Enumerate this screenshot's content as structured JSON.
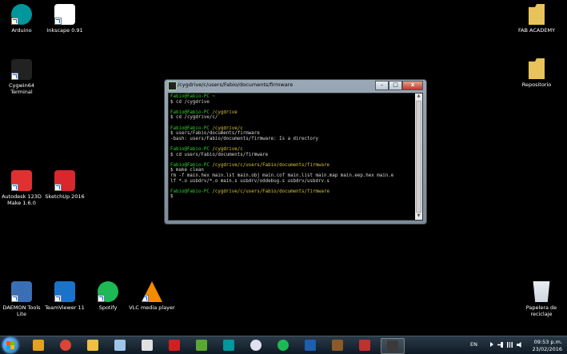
{
  "desktop": {
    "icons": [
      {
        "id": "arduino",
        "label": "Arduino",
        "icon": "arduino-icon",
        "color": "#00979c"
      },
      {
        "id": "inkscape",
        "label": "Inkscape 0.91",
        "icon": "inkscape-icon",
        "color": "#ffffff"
      },
      {
        "id": "fab",
        "label": "FAB ACADEMY",
        "icon": "folder-icon",
        "color": "#e8c35a"
      },
      {
        "id": "cygwin",
        "label": "Cygwin64\nTerminal",
        "icon": "cygwin-terminal-icon",
        "color": "#222222"
      },
      {
        "id": "repo",
        "label": "Repositorio",
        "icon": "folder-icon",
        "color": "#e8c35a"
      },
      {
        "id": "autodesk",
        "label": "Autodesk 123D\nMake 1.6.0",
        "icon": "autodesk-123d-make-icon",
        "color": "#e23030"
      },
      {
        "id": "sketchup",
        "label": "SketchUp 2016",
        "icon": "sketchup-icon",
        "color": "#d8272d"
      },
      {
        "id": "daemon",
        "label": "DAEMON Tools\nLite",
        "icon": "daemon-tools-icon",
        "color": "#3b6fb5"
      },
      {
        "id": "teamviewer",
        "label": "TeamViewer 11",
        "icon": "teamviewer-icon",
        "color": "#1a73c9"
      },
      {
        "id": "spotify",
        "label": "Spotify",
        "icon": "spotify-icon",
        "color": "#1db954"
      },
      {
        "id": "vlc",
        "label": "VLC media player",
        "icon": "vlc-icon",
        "color": "#f28b00"
      },
      {
        "id": "recycle",
        "label": "Papelera de\nreciclaje",
        "icon": "recycle-bin-icon",
        "color": "#cfd8e0"
      }
    ]
  },
  "terminal": {
    "title": "/cygdrive/c/users/Fabio/documents/firmware",
    "lines": [
      [
        {
          "c": "g",
          "t": "Fabio@Fabio-PC "
        },
        {
          "c": "y",
          "t": "~"
        }
      ],
      [
        {
          "c": "w",
          "t": "$ cd /cygdrive"
        }
      ],
      [
        {
          "c": "w",
          "t": ""
        }
      ],
      [
        {
          "c": "g",
          "t": "Fabio@Fabio-PC "
        },
        {
          "c": "y",
          "t": "/cygdrive"
        }
      ],
      [
        {
          "c": "w",
          "t": "$ cd /cygdrive/c/"
        }
      ],
      [
        {
          "c": "w",
          "t": ""
        }
      ],
      [
        {
          "c": "g",
          "t": "Fabio@Fabio-PC "
        },
        {
          "c": "y",
          "t": "/cygdrive/c"
        }
      ],
      [
        {
          "c": "w",
          "t": "$ users/Fabio/documents/firmware"
        }
      ],
      [
        {
          "c": "w",
          "t": "-bash: users/Fabio/documents/firmware: Is a directory"
        }
      ],
      [
        {
          "c": "w",
          "t": ""
        }
      ],
      [
        {
          "c": "g",
          "t": "Fabio@Fabio-PC "
        },
        {
          "c": "y",
          "t": "/cygdrive/c"
        }
      ],
      [
        {
          "c": "w",
          "t": "$ cd users/Fabio/documents/firmware"
        }
      ],
      [
        {
          "c": "w",
          "t": ""
        }
      ],
      [
        {
          "c": "g",
          "t": "Fabio@Fabio-PC "
        },
        {
          "c": "y",
          "t": "/cygdrive/c/users/Fabio/documents/firmware"
        }
      ],
      [
        {
          "c": "w",
          "t": "$ make clean"
        }
      ],
      [
        {
          "c": "w",
          "t": "rm -f main.hex main.lst main.obj main.cof main.list main.map main.eep.hex main.e"
        }
      ],
      [
        {
          "c": "w",
          "t": "lf *.o usbdrv/*.o main.s usbdrv/oddebug.s usbdrv/usbdrv.s"
        }
      ],
      [
        {
          "c": "w",
          "t": ""
        }
      ],
      [
        {
          "c": "g",
          "t": "Fabio@Fabio-PC "
        },
        {
          "c": "y",
          "t": "/cygdrive/c/users/Fabio/documents/firmware"
        }
      ],
      [
        {
          "c": "w",
          "t": "$"
        }
      ]
    ],
    "controls": {
      "minimize": "–",
      "maximize": "□",
      "close": "x"
    }
  },
  "taskbar": {
    "apps": [
      {
        "id": "explorer-ie",
        "icon": "media-player-icon",
        "color": "#e6a020"
      },
      {
        "id": "chrome",
        "icon": "chrome-icon",
        "color": "#db4437"
      },
      {
        "id": "file-explorer",
        "icon": "file-explorer-icon",
        "color": "#f0c040"
      },
      {
        "id": "notepad",
        "icon": "notepad-icon",
        "color": "#9ec4e8"
      },
      {
        "id": "inkscape",
        "icon": "inkscape-icon",
        "color": "#e0e0e0"
      },
      {
        "id": "autodesk",
        "icon": "autodesk-icon",
        "color": "#d02020"
      },
      {
        "id": "sketchup",
        "icon": "sketchup-icon",
        "color": "#5aa832"
      },
      {
        "id": "arduino",
        "icon": "arduino-icon",
        "color": "#00979c"
      },
      {
        "id": "itunes",
        "icon": "itunes-icon",
        "color": "#e0e0f0"
      },
      {
        "id": "spotify",
        "icon": "spotify-icon",
        "color": "#1db954"
      },
      {
        "id": "photoshop",
        "icon": "photoshop-icon",
        "color": "#1b5fae"
      },
      {
        "id": "tools",
        "icon": "tools-icon",
        "color": "#8a5a2a"
      },
      {
        "id": "screen",
        "icon": "presentation-icon",
        "color": "#c03030"
      },
      {
        "id": "cygwin",
        "icon": "cygwin-terminal-icon",
        "color": "#3a3a3a",
        "active": true
      }
    ],
    "tray": {
      "language": "EN",
      "time": "09:53 p.m.",
      "date": "23/02/2016"
    }
  }
}
